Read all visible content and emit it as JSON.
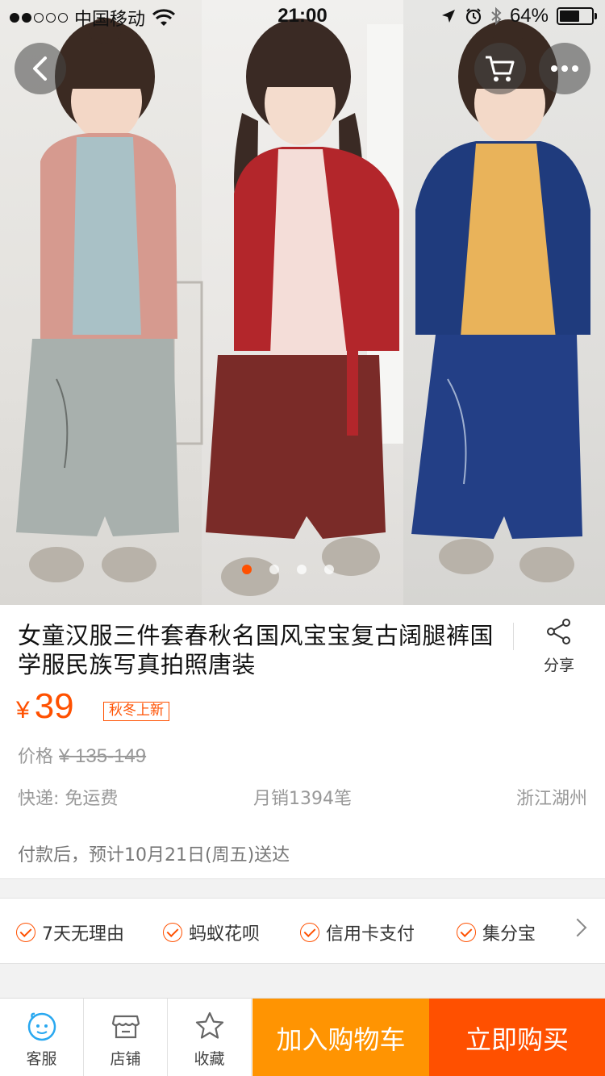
{
  "status_bar": {
    "carrier": "中国移动",
    "time": "21:00",
    "battery": "64%",
    "battery_level": 0.64,
    "signal_strength": 2
  },
  "gallery": {
    "image_count": 4,
    "active_index": 0
  },
  "product": {
    "title": "女童汉服三件套春秋名国风宝宝复古阔腿裤国学服民族写真拍照唐装",
    "share_label": "分享",
    "currency": "¥",
    "price": "39",
    "promo_tag": "秋冬上新",
    "orig_price_label": "价格",
    "orig_price": "¥ 135-149",
    "shipping": "快递: 免运费",
    "monthly_sales": "月销1394笔",
    "location": "浙江湖州",
    "delivery": "付款后，预计10月21日(周五)送达"
  },
  "services": [
    {
      "label": "7天无理由"
    },
    {
      "label": "蚂蚁花呗"
    },
    {
      "label": "信用卡支付"
    },
    {
      "label": "集分宝"
    }
  ],
  "bottom_bar": {
    "customer_service": "客服",
    "shop": "店铺",
    "favorite": "收藏",
    "add_to_cart": "加入购物车",
    "buy_now": "立即购买"
  },
  "colors": {
    "accent": "#ff5000",
    "cart_button": "#ff9402"
  },
  "icons": [
    "back-icon",
    "cart-icon",
    "more-icon",
    "share-icon",
    "check-circle-icon",
    "chevron-right-icon",
    "customer-service-icon",
    "shop-icon",
    "star-icon",
    "wifi-icon",
    "location-arrow-icon",
    "alarm-icon",
    "bluetooth-icon",
    "battery-icon"
  ]
}
